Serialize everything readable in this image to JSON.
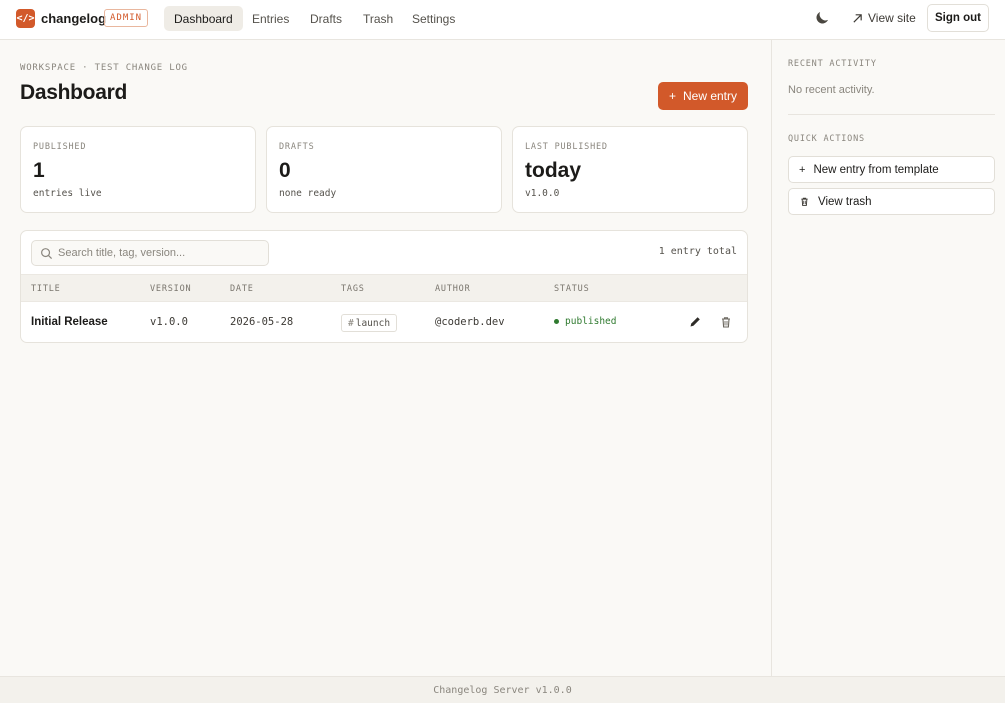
{
  "brand": {
    "logo_glyph": "</>",
    "name": "changelog",
    "badge": "ADMIN",
    "accent_color": "#d2592a"
  },
  "nav": {
    "items": [
      {
        "label": "Dashboard",
        "active": true
      },
      {
        "label": "Entries",
        "active": false
      },
      {
        "label": "Drafts",
        "active": false
      },
      {
        "label": "Trash",
        "active": false
      },
      {
        "label": "Settings",
        "active": false
      }
    ],
    "theme_icon": "moon-icon",
    "view_site": "View site",
    "sign_out": "Sign out"
  },
  "main": {
    "breadcrumb": "WORKSPACE · TEST CHANGE LOG",
    "title": "Dashboard",
    "new_entry_label": "New entry",
    "stats": [
      {
        "label": "PUBLISHED",
        "value": "1",
        "sub": "entries live"
      },
      {
        "label": "DRAFTS",
        "value": "0",
        "sub": "none ready"
      },
      {
        "label": "LAST PUBLISHED",
        "value": "today",
        "sub": "v1.0.0"
      }
    ],
    "search": {
      "placeholder": "Search title, tag, version..."
    },
    "total_label": "1 entry total",
    "table": {
      "columns": [
        "TITLE",
        "VERSION",
        "DATE",
        "TAGS",
        "AUTHOR",
        "STATUS"
      ],
      "rows": [
        {
          "title": "Initial Release",
          "version": "v1.0.0",
          "date": "2026-05-28",
          "tag_hash": "#",
          "tag": "launch",
          "author": "@coderb.dev",
          "status": "published",
          "status_color": "#2f7a2f"
        }
      ]
    }
  },
  "sidebar": {
    "recent_heading": "RECENT ACTIVITY",
    "recent_empty": "No recent activity.",
    "quick_heading": "QUICK ACTIONS",
    "quick_actions": [
      {
        "icon": "plus-icon",
        "label": "New entry from template"
      },
      {
        "icon": "trash-icon",
        "label": "View trash"
      }
    ]
  },
  "footer": {
    "text": "Changelog Server v1.0.0"
  }
}
